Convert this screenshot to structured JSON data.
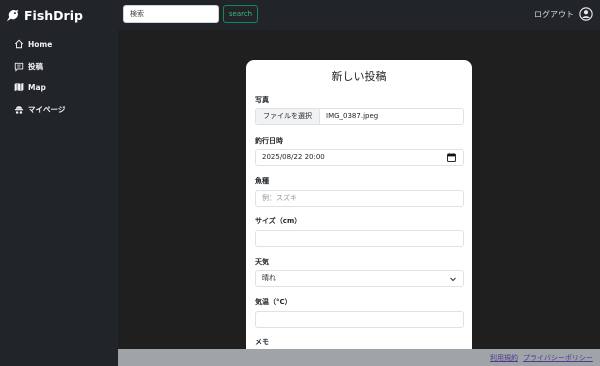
{
  "header": {
    "brand": "FishDrip",
    "search_placeholder": "検索",
    "search_button": "search",
    "logout": "ログアウト"
  },
  "sidebar": {
    "items": [
      {
        "label": "Home",
        "icon": "home-icon"
      },
      {
        "label": "投稿",
        "icon": "post-icon"
      },
      {
        "label": "Map",
        "icon": "map-icon"
      },
      {
        "label": "マイページ",
        "icon": "mypage-icon"
      }
    ]
  },
  "form": {
    "title": "新しい投稿",
    "photo_label": "写真",
    "file_button": "ファイルを選択",
    "file_name": "IMG_0387.jpeg",
    "datetime_label": "釣行日時",
    "datetime_value": "2025/08/22 20:00",
    "species_label": "魚種",
    "species_placeholder": "例：スズキ",
    "size_label": "サイズ（cm）",
    "size_value": "",
    "weather_label": "天気",
    "weather_value": "晴れ",
    "temp_label": "気温（°C）",
    "temp_value": "",
    "memo_label": "メモ"
  },
  "footer": {
    "terms": "利用規約",
    "privacy": "プライバシーポリシー"
  },
  "colors": {
    "background": "#1f1f1f",
    "nav": "#212529",
    "accent": "#198754",
    "footer": "#9fa4a8"
  }
}
